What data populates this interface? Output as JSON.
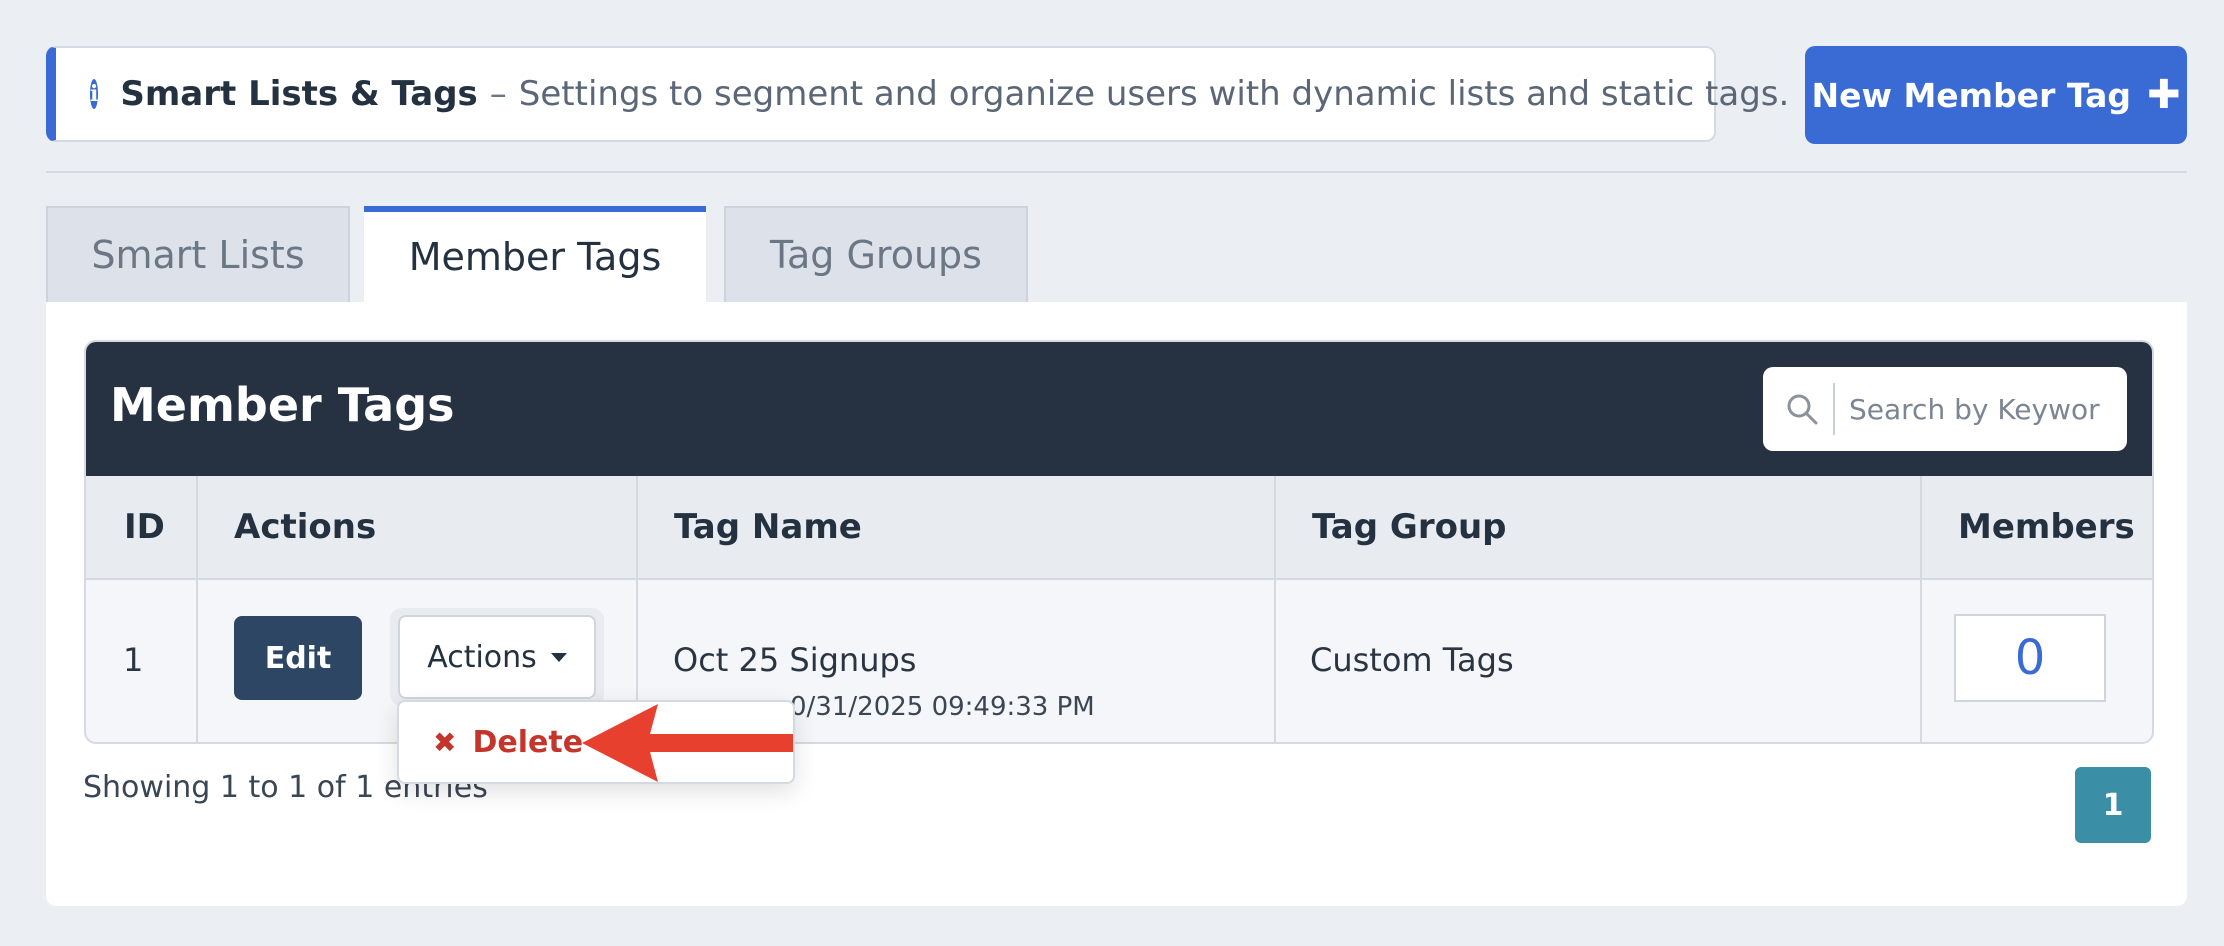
{
  "info": {
    "title": "Smart Lists & Tags",
    "separator": "–",
    "description": "Settings to segment and organize users with dynamic lists and static tags.",
    "icon": "info-icon"
  },
  "header_button": {
    "label": "New Member Tag",
    "icon": "plus-icon"
  },
  "tabs": [
    {
      "label": "Smart Lists",
      "active": false
    },
    {
      "label": "Member Tags",
      "active": true
    },
    {
      "label": "Tag Groups",
      "active": false
    }
  ],
  "card": {
    "title": "Member Tags",
    "search_placeholder": "Search by Keywor"
  },
  "table": {
    "columns": [
      "ID",
      "Actions",
      "Tag Name",
      "Tag Group",
      "Members"
    ],
    "rows": [
      {
        "id": "1",
        "edit_label": "Edit",
        "actions_label": "Actions",
        "tag_name": "Oct 25 Signups",
        "tag_date": "0/31/2025 09:49:33 PM",
        "tag_group": "Custom Tags",
        "members": "0"
      }
    ]
  },
  "dropdown": {
    "delete_label": "Delete"
  },
  "footer": {
    "entries_text": "Showing 1 to 1 of 1 entries",
    "page": "1"
  },
  "colors": {
    "accent": "#3a6ad3",
    "header_dark": "#263241",
    "delete_red": "#c4352b",
    "arrow_red": "#e8402e",
    "page_teal": "#3a8fa6"
  }
}
